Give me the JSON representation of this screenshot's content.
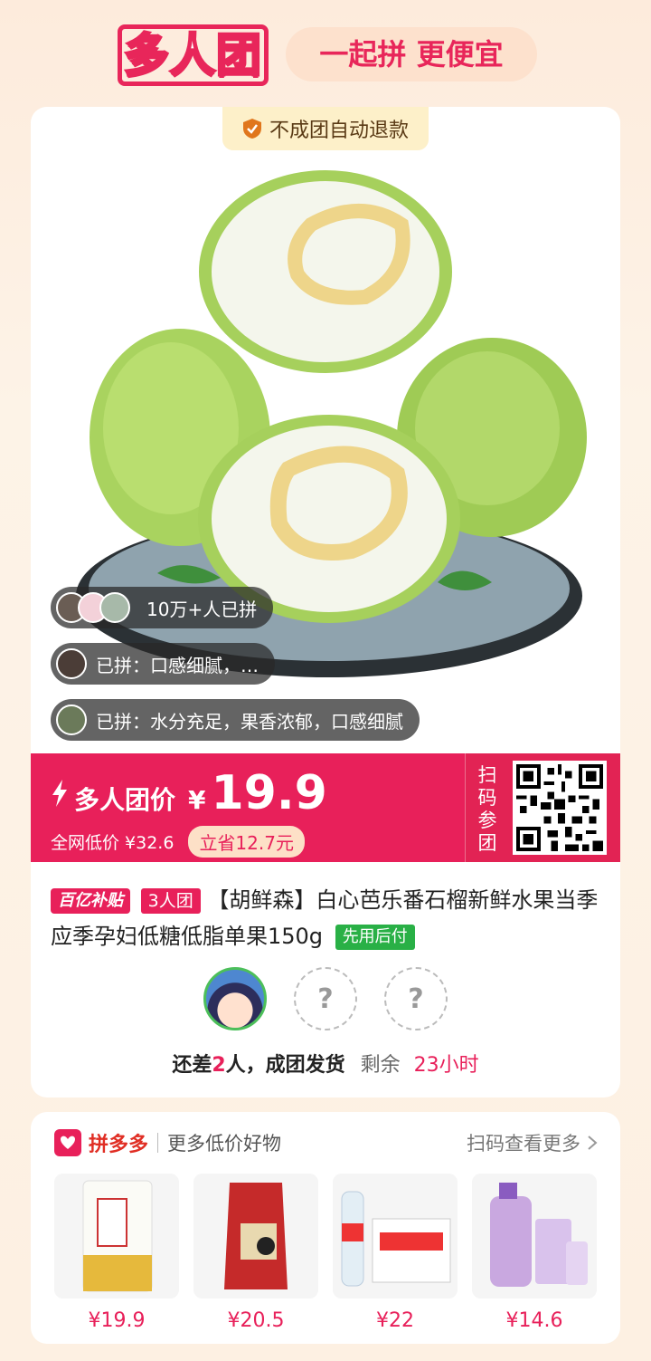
{
  "header": {
    "title": "多人团",
    "slogan": "一起拼 更便宜"
  },
  "product": {
    "refund_badge": "不成团自动退款",
    "joined_count": "10万+人已拼",
    "reviews": [
      "已拼：口感细腻，…",
      "已拼：水分充足，果香浓郁，口感细腻"
    ],
    "price_label": "多人团价",
    "currency": "¥",
    "price": "19.9",
    "market_price_label": "全网低价 ¥32.6",
    "save_label": "立省12.7元",
    "scan_label": "扫码参团",
    "subsidy_tag": "百亿补贴",
    "group_tag": "3人团",
    "title": "【胡鲜森】白心芭乐番石榴新鲜水果当季应季孕妇低糖低脂单果150g",
    "pay_tag": "先用后付",
    "empty_slot": "?",
    "status_prefix": "还差",
    "status_count": "2",
    "status_suffix": "人，成团发货",
    "remaining_label": "剩余",
    "remaining_time": "23小时"
  },
  "more": {
    "brand": "拼多多",
    "description": "更多低价好物",
    "link": "扫码查看更多",
    "goods": [
      {
        "price": "¥19.9",
        "icon": "flour-bag-icon"
      },
      {
        "price": "¥20.5",
        "icon": "rice-bag-icon"
      },
      {
        "price": "¥22",
        "icon": "water-bottles-icon"
      },
      {
        "price": "¥14.6",
        "icon": "softener-bottle-icon"
      }
    ]
  },
  "colors": {
    "accent": "#e8205a",
    "green": "#29b046",
    "background": "#fdf0e0"
  }
}
